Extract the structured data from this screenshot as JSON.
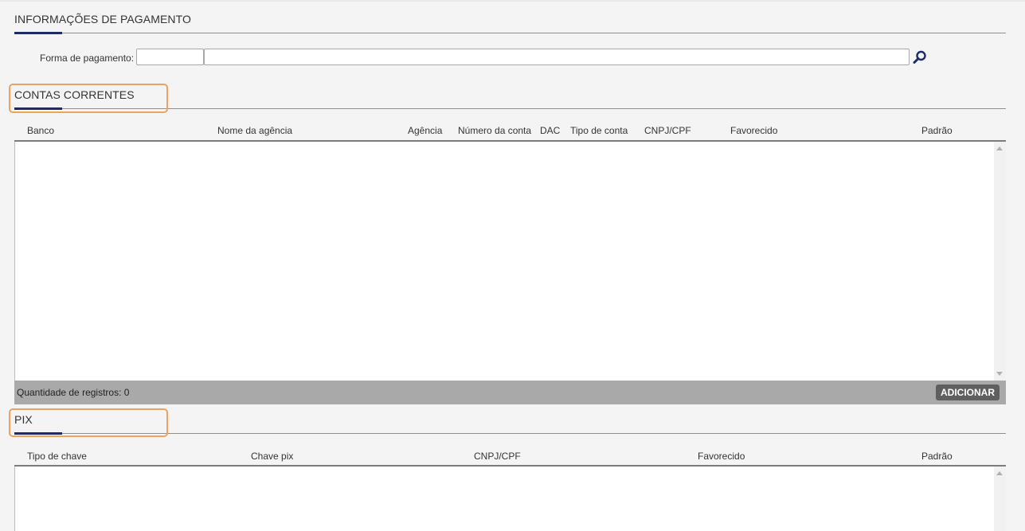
{
  "payment_info": {
    "title": "INFORMAÇÕES DE PAGAMENTO",
    "payment_method_label": "Forma de pagamento:",
    "payment_code_value": "",
    "payment_desc_value": "",
    "search_icon": "magnifier-icon"
  },
  "current_accounts": {
    "title": "CONTAS CORRENTES",
    "columns": [
      "Banco",
      "Nome da agência",
      "Agência",
      "Número da conta",
      "DAC",
      "Tipo de conta",
      "CNPJ/CPF",
      "Favorecido",
      "Padrão"
    ],
    "rows": [],
    "count_text": "Quantidade de registros: 0",
    "add_label": "ADICIONAR"
  },
  "pix": {
    "title": "PIX",
    "columns": [
      "Tipo de chave",
      "Chave pix",
      "CNPJ/CPF",
      "Favorecido",
      "Padrão"
    ],
    "rows": []
  },
  "colors": {
    "accent": "#1f2a6b",
    "highlight": "#f0a15c",
    "footer": "#a9a9a9",
    "button": "#5f5f5f"
  }
}
